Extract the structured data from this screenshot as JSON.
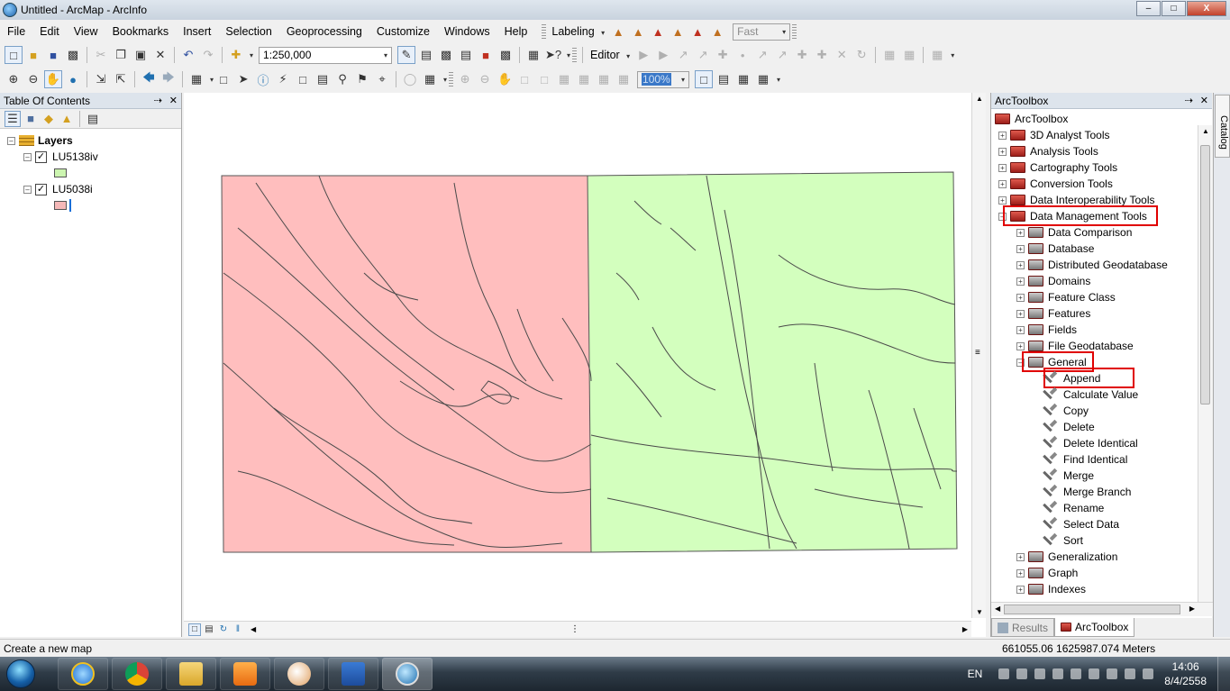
{
  "window": {
    "title": "Untitled - ArcMap - ArcInfo",
    "buttons": {
      "minimize": "–",
      "maximize": "□",
      "close": "X"
    }
  },
  "menu": [
    "File",
    "Edit",
    "View",
    "Bookmarks",
    "Insert",
    "Selection",
    "Geoprocessing",
    "Customize",
    "Windows",
    "Help"
  ],
  "labeling": {
    "label": "Labeling",
    "quality": "Fast"
  },
  "toolbar": {
    "scale": "1:250,000",
    "editor": "Editor",
    "zoom_percent": "100%"
  },
  "toc": {
    "title": "Table Of Contents",
    "root": "Layers",
    "layers": [
      {
        "name": "LU5138iv",
        "checked": true,
        "color": "#ccf5b0"
      },
      {
        "name": "LU5038i",
        "checked": true,
        "color": "#f5b8b8"
      }
    ]
  },
  "map": {
    "left_color": "#ffbebe",
    "right_color": "#d3ffbe"
  },
  "toolbox": {
    "title": "ArcToolbox",
    "root": "ArcToolbox",
    "toolsets": [
      "3D Analyst Tools",
      "Analysis Tools",
      "Cartography Tools",
      "Conversion Tools",
      "Data Interoperability Tools",
      "Data Management Tools"
    ],
    "dm_children": [
      "Data Comparison",
      "Database",
      "Distributed Geodatabase",
      "Domains",
      "Feature Class",
      "Features",
      "Fields",
      "File Geodatabase",
      "General"
    ],
    "general_tools": [
      "Append",
      "Calculate Value",
      "Copy",
      "Delete",
      "Delete Identical",
      "Find Identical",
      "Merge",
      "Merge Branch",
      "Rename",
      "Select Data",
      "Sort"
    ],
    "after_general": [
      "Generalization",
      "Graph",
      "Indexes"
    ],
    "tabs": [
      "Results",
      "ArcToolbox"
    ],
    "highlight_color": "#e00000"
  },
  "catalog_tab": "Catalog",
  "status": {
    "message": "Create a new map",
    "coords": "661055.06  1625987.074 Meters"
  },
  "taskbar": {
    "lang": "EN",
    "time": "14:06",
    "date": "8/4/2558",
    "apps": [
      "internet-explorer",
      "chrome",
      "explorer",
      "media-player",
      "paint",
      "word",
      "arcmap"
    ]
  }
}
